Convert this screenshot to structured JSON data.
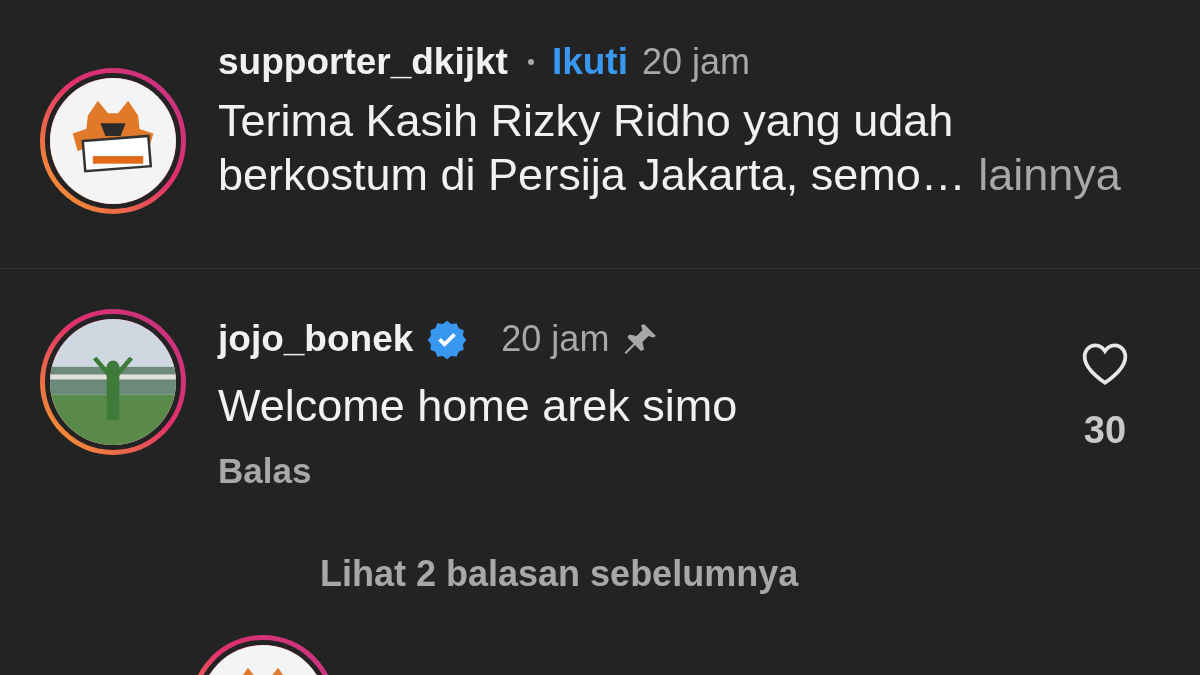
{
  "comments": [
    {
      "username": "supporter_dkijkt",
      "verified": false,
      "follow": "Ikuti",
      "time": "20 jam",
      "pinned": false,
      "text": "Terima Kasih Rizky Ridho yang udah berkostum di Persija Jakarta, semo…",
      "more": "lainnya"
    },
    {
      "username": "jojo_bonek",
      "verified": true,
      "time": "20 jam",
      "pinned": true,
      "text": "Welcome home arek simo",
      "reply": "Balas",
      "likes": "30",
      "liked": false
    }
  ],
  "view_replies": "Lihat 2 balasan sebelumnya"
}
